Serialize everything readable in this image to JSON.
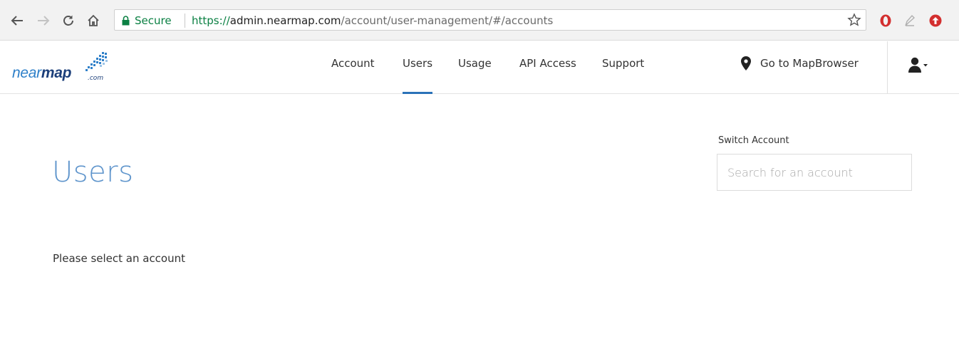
{
  "browser": {
    "secure_label": "Secure",
    "url_scheme": "https://",
    "url_host": "admin.nearmap.com",
    "url_path": "/account/user-management/#/accounts"
  },
  "header": {
    "logo_near": "near",
    "logo_map": "map",
    "logo_sub": ".com",
    "nav": {
      "account": "Account",
      "users": "Users",
      "usage": "Usage",
      "api_access": "API Access",
      "support": "Support"
    },
    "active_nav": "Users",
    "mapbrowser_label": "Go to MapBrowser"
  },
  "main": {
    "title": "Users",
    "switch_account_label": "Switch Account",
    "search_placeholder": "Search for an account",
    "search_value": "",
    "message": "Please select an account"
  },
  "colors": {
    "accent": "#2b72b8",
    "title": "#5f95cc",
    "secure_green": "#0b8043"
  }
}
